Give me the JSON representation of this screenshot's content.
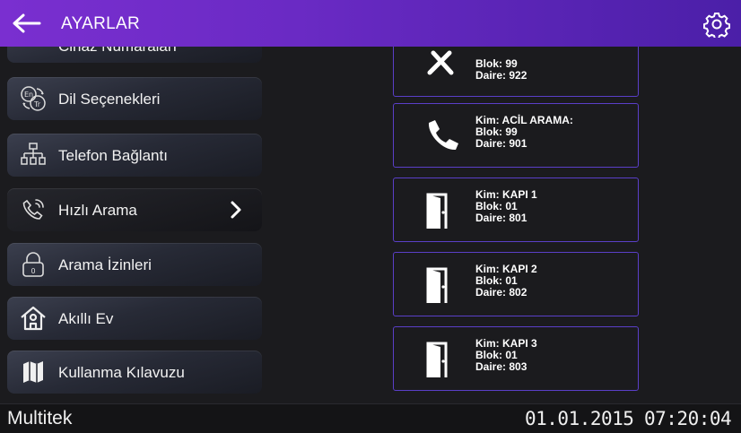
{
  "header": {
    "title": "AYARLAR"
  },
  "menu": {
    "items": [
      {
        "label": "Cihaz Numaraları",
        "icon": "grid-icon"
      },
      {
        "label": "Dil Seçenekleri",
        "icon": "language-icon"
      },
      {
        "label": "Telefon Bağlantı",
        "icon": "network-icon"
      },
      {
        "label": "Hızlı Arama",
        "icon": "phone-ring-icon",
        "selected": true
      },
      {
        "label": "Arama İzinleri",
        "icon": "lock-icon"
      },
      {
        "label": "Akıllı Ev",
        "icon": "smart-home-icon"
      },
      {
        "label": "Kullanma Kılavuzu",
        "icon": "map-icon"
      }
    ]
  },
  "contacts": [
    {
      "kim": "",
      "blok": "Blok: 99",
      "daire": "Daire: 922",
      "icon": "tools-icon"
    },
    {
      "kim": "Kim: ACİL ARAMA:",
      "blok": "Blok: 99",
      "daire": "Daire: 901",
      "icon": "phone-icon"
    },
    {
      "kim": "Kim: KAPI 1",
      "blok": "Blok: 01",
      "daire": "Daire: 801",
      "icon": "door-icon"
    },
    {
      "kim": "Kim: KAPI 2",
      "blok": "Blok: 01",
      "daire": "Daire: 802",
      "icon": "door-icon"
    },
    {
      "kim": "Kim: KAPI 3",
      "blok": "Blok: 01",
      "daire": "Daire: 803",
      "icon": "door-icon"
    }
  ],
  "status": {
    "brand": "Multitek",
    "date": "01.01.2015",
    "time": "07:20:04"
  },
  "colors": {
    "header_start": "#7a2fd0",
    "header_end": "#4b1fa8",
    "card_border": "#5a3fc8"
  }
}
